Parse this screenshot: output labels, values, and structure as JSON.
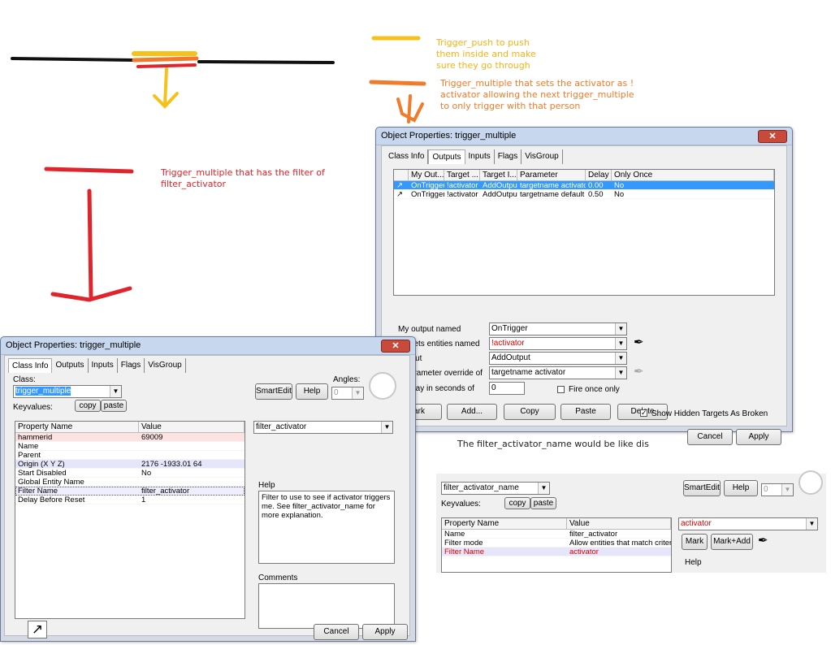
{
  "annotations": {
    "push_note": "Trigger_push to push\nthem inside and make\nsure they go through",
    "multiple_note": "Trigger_multiple that sets the activator as !\nactivator allowing the next trigger_multiple\nto only trigger with that person",
    "filter_note": "Trigger_multiple that has the filter of\nfilter_activator",
    "filter_name_note": "The filter_activator_name would be like dis",
    "colors": {
      "yellow": "#f5c21b",
      "orange": "#f07b2a",
      "red": "#e0242b"
    }
  },
  "window_outputs": {
    "title": "Object Properties: trigger_multiple",
    "close": "✕",
    "tabs": [
      "Class Info",
      "Outputs",
      "Inputs",
      "Flags",
      "VisGroup"
    ],
    "columns": [
      "My Out...",
      "Target ...",
      "Target I...",
      "Parameter",
      "Delay",
      "Only Once"
    ],
    "rows": [
      [
        "OnTrigger",
        "!activator",
        "AddOutput",
        "targetname activator",
        "0.00",
        "No"
      ],
      [
        "OnTrigger",
        "!activator",
        "AddOutput",
        "targetname default",
        "0.50",
        "No"
      ]
    ],
    "labels": {
      "output_named": "My output named",
      "targets": "Targets entities named",
      "via_input": "s input",
      "param_override": "n parameter override of",
      "delay": "n delay in seconds of"
    },
    "values": {
      "output_named": "OnTrigger",
      "targets": "!activator",
      "via_input": "AddOutput",
      "param_override": "targetname activator",
      "delay": "0"
    },
    "fire_once": "Fire once only",
    "buttons": {
      "mark": "ark",
      "add": "Add...",
      "copy": "Copy",
      "paste": "Paste",
      "delete": "Delete"
    },
    "show_hidden": "Show Hidden Targets As Broken",
    "cancel": "Cancel",
    "apply": "Apply"
  },
  "window_classinfo": {
    "title": "Object Properties: trigger_multiple",
    "close": "✕",
    "tabs": [
      "Class Info",
      "Outputs",
      "Inputs",
      "Flags",
      "VisGroup"
    ],
    "class_label": "Class:",
    "class_value": "trigger_multiple",
    "smartedit": "SmartEdit",
    "help": "Help",
    "angles_label": "Angles:",
    "angles_value": "0",
    "keyvalues": "Keyvalues:",
    "copy": "copy",
    "paste": "paste",
    "columns": [
      "Property Name",
      "Value"
    ],
    "rows": [
      [
        "hammerid",
        "69009"
      ],
      [
        "Name",
        ""
      ],
      [
        "Parent",
        ""
      ],
      [
        "Origin (X Y Z)",
        "2176 -1933.01 64"
      ],
      [
        "Start Disabled",
        "No"
      ],
      [
        "Global Entity Name",
        ""
      ],
      [
        "Filter Name",
        "filter_activator"
      ],
      [
        "Delay Before Reset",
        "1"
      ]
    ],
    "value_select": "filter_activator",
    "help_label": "Help",
    "help_text": "Filter to use to see if activator triggers me. See filter_activator_name for more explanation.",
    "comments_label": "Comments",
    "cancel": "Cancel",
    "apply": "Apply"
  },
  "filter_panel": {
    "class_value": "filter_activator_name",
    "keyvalues": "Keyvalues:",
    "copy": "copy",
    "paste": "paste",
    "smartedit": "SmartEdit",
    "help": "Help",
    "angles_value": "0",
    "columns": [
      "Property Name",
      "Value"
    ],
    "rows": [
      [
        "Name",
        "filter_activator"
      ],
      [
        "Filter mode",
        "Allow entities that match criteria"
      ],
      [
        "Filter Name",
        "activator"
      ]
    ],
    "value_select": "activator",
    "mark": "Mark",
    "mark_add": "Mark+Add",
    "help_label": "Help"
  }
}
